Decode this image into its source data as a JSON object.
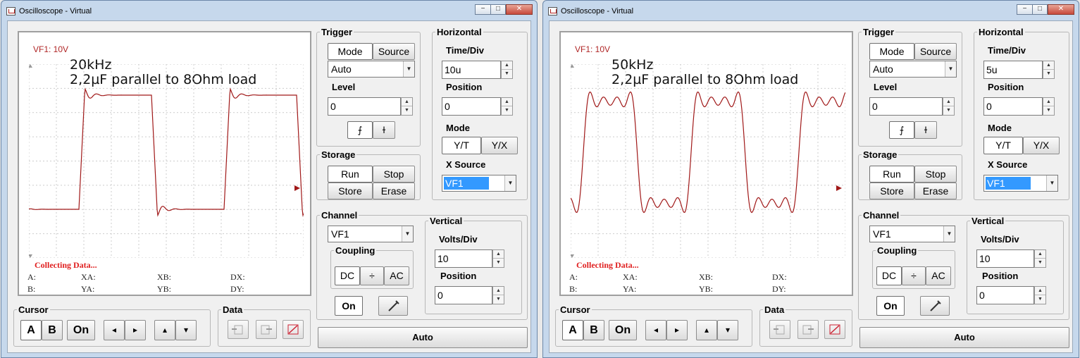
{
  "windows": [
    {
      "title": "Oscilloscope - Virtual",
      "controls": {
        "minimize": "−",
        "maximize": "□",
        "close": "✕"
      },
      "screen": {
        "channel_label": "VF1: 10V",
        "note_line1": "20kHz",
        "note_line2": "2,2µF parallel to 8Ohm load",
        "status": "Collecting Data...",
        "cursor_labels": {
          "a": "A:",
          "b": "B:",
          "xa": "XA:",
          "ya": "YA:",
          "xb": "XB:",
          "yb": "YB:",
          "dx": "DX:",
          "dy": "DY:"
        }
      },
      "trace": {
        "signal_frequency": "20kHz",
        "volts_per_div": 10,
        "time_per_div": "10u"
      },
      "trigger": {
        "title": "Trigger",
        "mode_label": "Mode",
        "source_label": "Source",
        "mode_value": "Auto",
        "level_label": "Level",
        "level_value": "0",
        "rising_edge": "⨍",
        "falling_edge": "ɫ"
      },
      "horizontal": {
        "title": "Horizontal",
        "time_div_label": "Time/Div",
        "time_div_value": "10u",
        "position_label": "Position",
        "position_value": "0",
        "mode_label": "Mode",
        "yt_label": "Y/T",
        "yx_label": "Y/X",
        "xsource_label": "X Source",
        "xsource_value": "VF1"
      },
      "storage": {
        "title": "Storage",
        "run_label": "Run",
        "stop_label": "Stop",
        "store_label": "Store",
        "erase_label": "Erase"
      },
      "channel": {
        "title": "Channel",
        "value": "VF1",
        "coupling_label": "Coupling",
        "dc_label": "DC",
        "gnd_label": "÷",
        "ac_label": "AC",
        "on_label": "On"
      },
      "vertical": {
        "title": "Vertical",
        "volts_div_label": "Volts/Div",
        "volts_div_value": "10",
        "position_label": "Position",
        "position_value": "0"
      },
      "cursor": {
        "title": "Cursor",
        "a_label": "A",
        "b_label": "B",
        "on_label": "On",
        "left": "◂",
        "right": "▸",
        "up": "▴",
        "down": "▾"
      },
      "data": {
        "title": "Data"
      },
      "auto_label": "Auto"
    },
    {
      "title": "Oscilloscope - Virtual",
      "controls": {
        "minimize": "−",
        "maximize": "□",
        "close": "✕"
      },
      "screen": {
        "channel_label": "VF1: 10V",
        "note_line1": "50kHz",
        "note_line2": "2,2µF parallel to 8Ohm load",
        "status": "Collecting Data...",
        "cursor_labels": {
          "a": "A:",
          "b": "B:",
          "xa": "XA:",
          "ya": "YA:",
          "xb": "XB:",
          "yb": "YB:",
          "dx": "DX:",
          "dy": "DY:"
        }
      },
      "trace": {
        "signal_frequency": "50kHz",
        "volts_per_div": 10,
        "time_per_div": "5u"
      },
      "trigger": {
        "title": "Trigger",
        "mode_label": "Mode",
        "source_label": "Source",
        "mode_value": "Auto",
        "level_label": "Level",
        "level_value": "0",
        "rising_edge": "⨍",
        "falling_edge": "ɫ"
      },
      "horizontal": {
        "title": "Horizontal",
        "time_div_label": "Time/Div",
        "time_div_value": "5u",
        "position_label": "Position",
        "position_value": "0",
        "mode_label": "Mode",
        "yt_label": "Y/T",
        "yx_label": "Y/X",
        "xsource_label": "X Source",
        "xsource_value": "VF1"
      },
      "storage": {
        "title": "Storage",
        "run_label": "Run",
        "stop_label": "Stop",
        "store_label": "Store",
        "erase_label": "Erase"
      },
      "channel": {
        "title": "Channel",
        "value": "VF1",
        "coupling_label": "Coupling",
        "dc_label": "DC",
        "gnd_label": "÷",
        "ac_label": "AC",
        "on_label": "On"
      },
      "vertical": {
        "title": "Vertical",
        "volts_div_label": "Volts/Div",
        "volts_div_value": "10",
        "position_label": "Position",
        "position_value": "0"
      },
      "cursor": {
        "title": "Cursor",
        "a_label": "A",
        "b_label": "B",
        "on_label": "On",
        "left": "◂",
        "right": "▸",
        "up": "▴",
        "down": "▾"
      },
      "data": {
        "title": "Data"
      },
      "auto_label": "Auto"
    }
  ],
  "colors": {
    "trace": "#a01818",
    "grid": "#cccccc",
    "selection": "#3399ff",
    "status": "#e02020"
  }
}
